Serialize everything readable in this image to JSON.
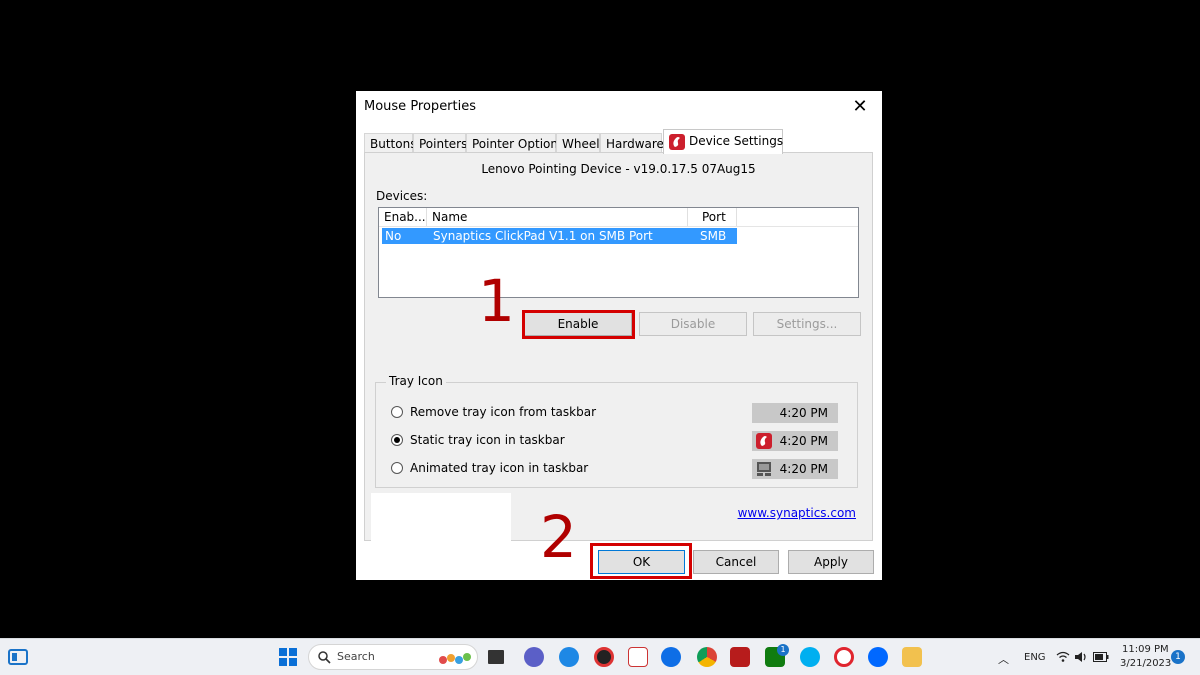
{
  "dialog": {
    "title": "Mouse Properties",
    "close_glyph": "✕",
    "tabs": [
      "Buttons",
      "Pointers",
      "Pointer Options",
      "Wheel",
      "Hardware",
      "Device Settings"
    ],
    "active_tab": "Device Settings",
    "version_text": "Lenovo Pointing Device - v19.0.17.5 07Aug15",
    "devices_label": "Devices:",
    "columns": [
      "Enab...",
      "Name",
      "Port"
    ],
    "rows": [
      {
        "enabled": "No",
        "name": "Synaptics ClickPad V1.1 on SMB Port",
        "port": "SMB"
      }
    ],
    "buttons": {
      "enable": "Enable",
      "disable": "Disable",
      "settings": "Settings..."
    },
    "tray_group_title": "Tray Icon",
    "tray_options": [
      {
        "label": "Remove tray icon from taskbar",
        "checked": false,
        "preview_time": "4:20 PM",
        "icon": "none"
      },
      {
        "label": "Static tray icon in taskbar",
        "checked": true,
        "preview_time": "4:20 PM",
        "icon": "synaptics-icon"
      },
      {
        "label": "Animated tray icon in taskbar",
        "checked": false,
        "preview_time": "4:20 PM",
        "icon": "touchpad-icon"
      }
    ],
    "link": "www.synaptics.com",
    "footer_buttons": {
      "ok": "OK",
      "cancel": "Cancel",
      "apply": "Apply"
    },
    "accent_color": "#cc1f2d",
    "selection_color": "#3399ff"
  },
  "annotations": {
    "step1": "1",
    "step2": "2",
    "color": "#d40000"
  },
  "taskbar": {
    "search_placeholder": "Search",
    "lang": "ENG",
    "time": "11:09 PM",
    "date": "3/21/2023",
    "notification_count": "1",
    "badges": {
      "xbox": "1"
    }
  }
}
